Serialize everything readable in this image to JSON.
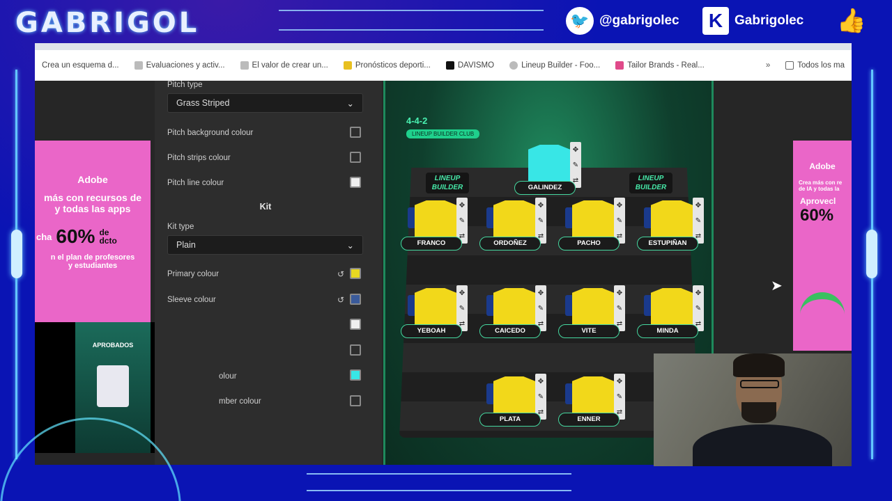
{
  "overlay": {
    "brand": "GABRIGOL",
    "twitter_handle": "@gabrigolec",
    "kick_handle": "Gabrigolec",
    "accent": "#0a14b4"
  },
  "bookmarks": [
    "Crea un esquema d...",
    "Evaluaciones y activ...",
    "El valor de crear un...",
    "Pronósticos deporti...",
    "DAVISMO",
    "Lineup Builder - Foo...",
    "Tailor Brands - Real..."
  ],
  "bookmarks_more": "»",
  "bookmarks_folder": "Todos los ma",
  "panel": {
    "pitch_type_label": "Pitch type",
    "pitch_type_value": "Grass Striped",
    "pitch_bg_label": "Pitch background colour",
    "pitch_strips_label": "Pitch strips colour",
    "pitch_line_label": "Pitch line colour",
    "kit_title": "Kit",
    "kit_type_label": "Kit type",
    "kit_type_value": "Plain",
    "primary_label": "Primary colour",
    "sleeve_label": "Sleeve colour",
    "partial_label_1": "olour",
    "partial_label_2": "mber colour",
    "primary_color": "#e8d820",
    "sleeve_color": "#3a5a9a",
    "gk_color": "#38e6e6"
  },
  "ad_left": {
    "brand": "Adobe",
    "line1": "más con recursos de",
    "line2": "y todas las apps",
    "discount_prefix": "cha",
    "discount": "60%",
    "discount_suffix1": "de",
    "discount_suffix2": "dcto",
    "line3": "n el plan de profesores",
    "line4": "y estudiantes"
  },
  "ad_right": {
    "brand": "Adobe",
    "line1": "Crea más con re",
    "line2": "de IA y todas la",
    "cta": "Aprovecl",
    "discount": "60%"
  },
  "video_popup": {
    "close": "×",
    "caption": "APROBADOS"
  },
  "pitch": {
    "formation": "4-4-2",
    "formation_sub": "LINEUP BUILDER CLUB",
    "logo_line1": "LINEUP",
    "logo_line2": "BUILDER",
    "players": {
      "gk": "GALINDEZ",
      "d1": "FRANCO",
      "d2": "ORDOÑEZ",
      "d3": "PACHO",
      "d4": "ESTUPIÑAN",
      "m1": "YEBOAH",
      "m2": "CAICEDO",
      "m3": "VITE",
      "m4": "MINDA",
      "f1": "PLATA",
      "f2": "ENNER"
    },
    "tool_icons": [
      "move-icon",
      "edit-icon",
      "swap-icon"
    ]
  }
}
